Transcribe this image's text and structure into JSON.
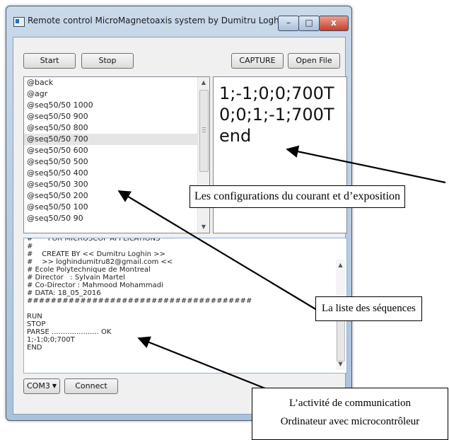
{
  "window": {
    "title": "Remote control MicroMagnetoaxis system by Dumitru Loghin",
    "controls": {
      "minimize": "–",
      "maximize": "□",
      "close": "x"
    }
  },
  "toolbar": {
    "start_label": "Start",
    "stop_label": "Stop",
    "capture_label": "CAPTURE",
    "open_file_label": "Open File"
  },
  "sequence_list": {
    "items": [
      "@back",
      "@agr",
      "@seq50/50 1000",
      "@seq50/50 900",
      "@seq50/50 800",
      "@seq50/50 700",
      "@seq50/50 600",
      "@seq50/50 500",
      "@seq50/50 400",
      "@seq50/50 300",
      "@seq50/50 200",
      "@seq50/50 100",
      "@seq50/50 90"
    ],
    "selected_index": 5
  },
  "config_display": {
    "lines": [
      "1;-1;0;0;700T",
      "0;0;1;-1;700T",
      "end"
    ]
  },
  "console": {
    "lines": [
      "# *** FOR MICROSCOP APPLICATIONS ***",
      "#",
      "#    CREATE BY << Dumitru Loghin >>",
      "#    >> loghindumitru82@gmail.com <<",
      "# Ecole Polytechnique de Montreal",
      "# Director   : Sylvain Martel",
      "# Co-Director : Mahmood Mohammadi",
      "# DATA: 18_05_2016",
      "######################################",
      "",
      "RUN",
      "STOP",
      "PARSE ..................... OK",
      "1;-1;0;0;700T",
      "END"
    ]
  },
  "bottom_bar": {
    "port_value": "COM3",
    "connect_label": "Connect"
  },
  "annotations": {
    "config_label": "Les configurations du courant et d’exposition",
    "sequence_label": "La liste des séquences",
    "comm_line1": "L’activité de communication",
    "comm_line2": "Ordinateur avec microcontrôleur"
  }
}
